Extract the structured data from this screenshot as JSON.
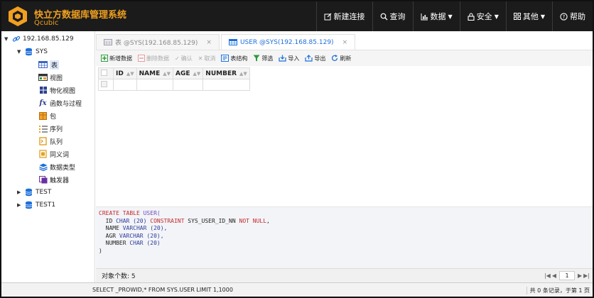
{
  "app": {
    "title": "快立方数据库管理系统",
    "subtitle": "Qcubic"
  },
  "nav": {
    "new_connection": "新建连接",
    "query": "查询",
    "data": "数据",
    "security": "安全",
    "other": "其他",
    "help": "帮助"
  },
  "tree": {
    "connection": "192.168.85.129",
    "schema_sys": "SYS",
    "items": [
      "表",
      "视图",
      "物化视图",
      "函数与过程",
      "包",
      "序列",
      "队列",
      "同义词",
      "数据类型",
      "触发器"
    ],
    "schema_test": "TEST",
    "schema_test1": "TEST1"
  },
  "tabs": [
    {
      "label": "表 @SYS(192.168.85.129)",
      "close": "×"
    },
    {
      "label": "USER @SYS(192.168.85.129)",
      "close": "×"
    }
  ],
  "toolbar": {
    "add": "新增数据",
    "delete": "删除数据",
    "confirm": "确认",
    "cancel": "取消",
    "structure": "表结构",
    "filter": "筛选",
    "import": "导入",
    "export": "导出",
    "refresh": "刷新"
  },
  "grid": {
    "columns": [
      "ID",
      "NAME",
      "AGE",
      "NUMBER"
    ]
  },
  "sql_text": {
    "l1a": "CREATE TABLE",
    "l1b": " USER(",
    "l2a": "  ID ",
    "l2b": "CHAR",
    "l2c": " (20) ",
    "l2d": "CONSTRAINT",
    "l2e": " SYS_USER_ID_NN ",
    "l2f": "NOT NULL",
    "l2g": ",",
    "l3a": "  NAME ",
    "l3b": "VARCHAR",
    "l3c": " (20),",
    "l4a": "  AGR ",
    "l4b": "VARCHAR",
    "l4c": " (20),",
    "l5a": "  NUMBER ",
    "l5b": "CHAR",
    "l5c": " (20)",
    "l6": ")"
  },
  "status": {
    "object_count": "对象个数:  5",
    "page": "1"
  },
  "bottom": {
    "sql": "SELECT _PROWID,* FROM SYS.USER LIMIT 1,1000",
    "summary": "共 0 条记录，于第 1 页"
  },
  "colors": {
    "header_bg": "#1b1b1b",
    "brand": "#f0a020",
    "accent": "#1e6fd9"
  }
}
